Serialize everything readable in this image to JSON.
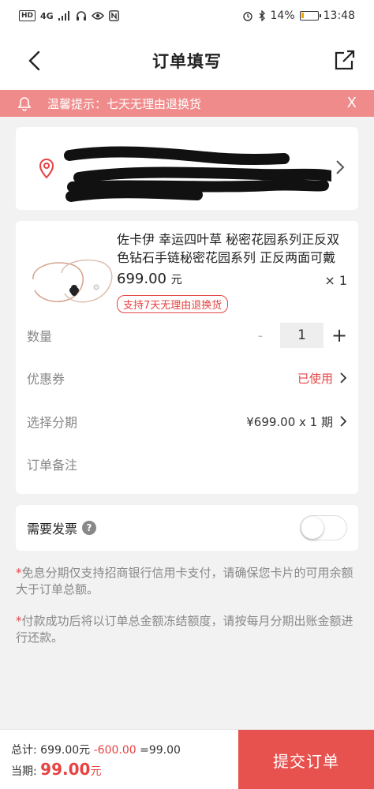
{
  "status_bar": {
    "left_label": "HD",
    "signal_label": "4G",
    "battery": "14%",
    "battery_level": 0.14,
    "time": "13:48"
  },
  "header": {
    "title": "订单填写",
    "back_icon": "back-arrow-icon",
    "share_icon": "external-link-icon"
  },
  "notice": {
    "text": "温馨提示：七天无理由退换货",
    "close_label": "X"
  },
  "product": {
    "name": "佐卡伊 幸运四叶草 秘密花园系列正反双色钻石手链秘密花园系列 正反两面可戴",
    "price": "699.00",
    "price_unit": "元",
    "quantity_label": "× 1",
    "tag": "支持7天无理由退换货"
  },
  "rows": {
    "quantity_label": "数量",
    "quantity_minus": "-",
    "quantity_value": "1",
    "quantity_plus": "+",
    "coupon_label": "优惠券",
    "coupon_value": "已使用",
    "installment_label": "选择分期",
    "installment_value": "¥699.00 x 1 期",
    "remark_label": "订单备注"
  },
  "invoice": {
    "label": "需要发票",
    "help": "?",
    "enabled": false
  },
  "notes": [
    {
      "star": "*",
      "text": "免息分期仅支持招商银行信用卡支付，请确保您卡片的可用余额大于订单总额。"
    },
    {
      "star": "*",
      "text": "付款成功后将以订单总金额冻结额度，请按每月分期出账金额进行还款。"
    }
  ],
  "bottom": {
    "total_label": "总计:",
    "total_amount": "699.00元",
    "discount": "-600.00",
    "result": "=99.00",
    "current_label": "当期:",
    "current_amount": "99.00",
    "current_unit": "元",
    "submit": "提交订单"
  },
  "colors": {
    "accent": "#e64343",
    "notice_bg": "#f08b8b",
    "submit_bg": "#e8524e"
  }
}
